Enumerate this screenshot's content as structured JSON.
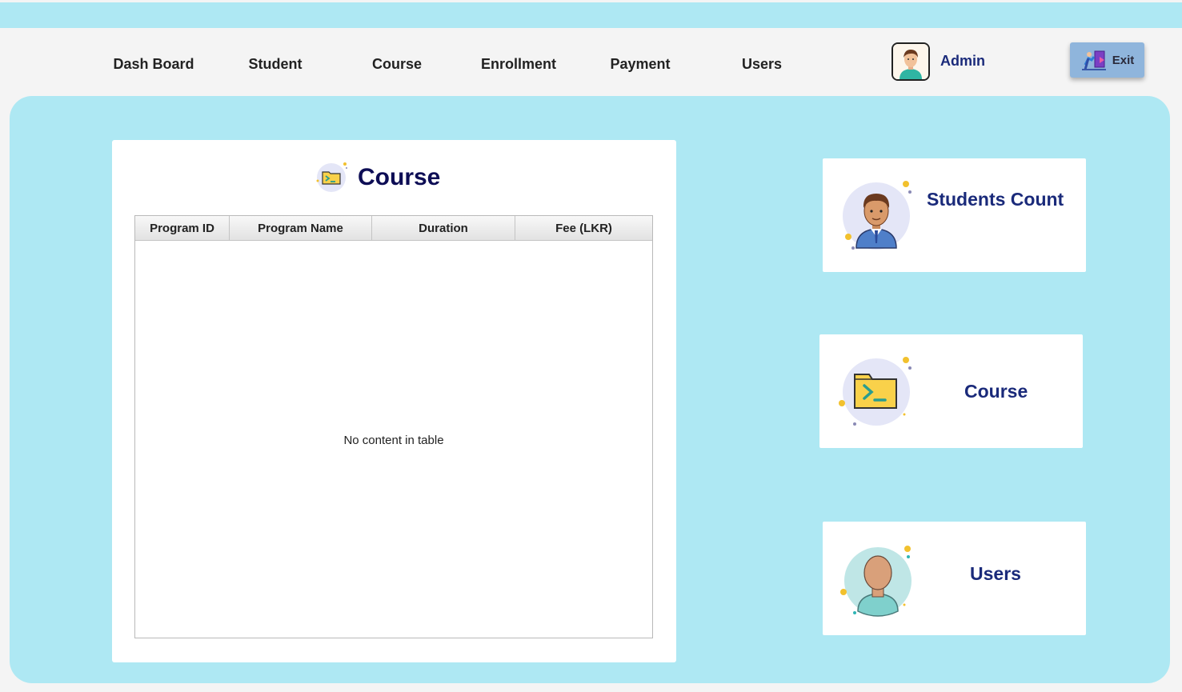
{
  "nav": {
    "items": [
      "Dash Board",
      "Student",
      "Course",
      "Enrollment",
      "Payment",
      "Users"
    ],
    "user_label": "Admin",
    "exit_label": "Exit"
  },
  "course_panel": {
    "title": "Course",
    "columns": [
      "Program ID",
      "Program Name",
      "Duration",
      "Fee (LKR)"
    ],
    "empty_message": "No content in table"
  },
  "cards": {
    "students": {
      "label": "Students Count",
      "icon": "student-avatar-icon"
    },
    "course": {
      "label": "Course",
      "icon": "terminal-folder-icon"
    },
    "users": {
      "label": "Users",
      "icon": "user-avatar-icon"
    }
  },
  "colors": {
    "accent_bg": "#aee8f3",
    "title_text": "#0d0d55",
    "label_text": "#1a2a7a",
    "exit_button": "#8fb5dc"
  }
}
